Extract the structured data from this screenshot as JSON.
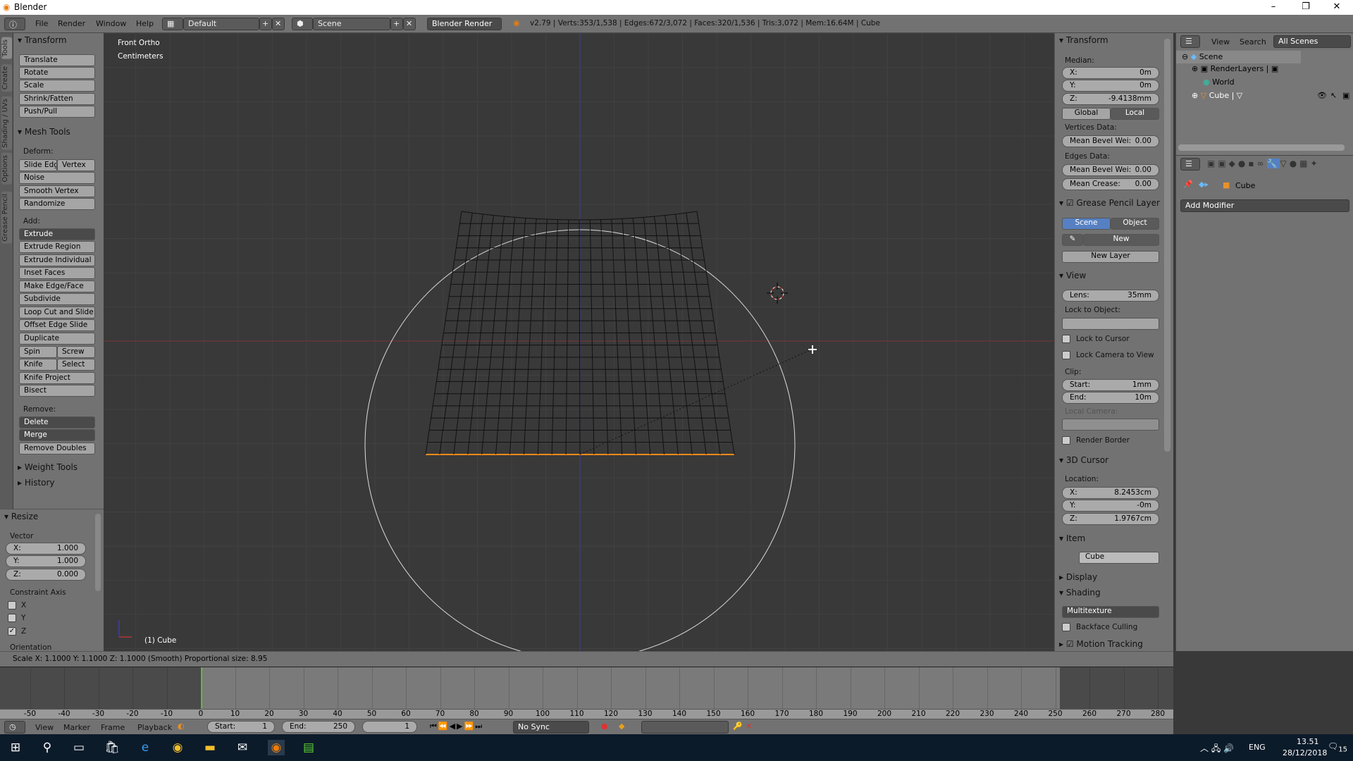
{
  "window": {
    "title": "Blender",
    "controls": [
      "–",
      "❐",
      "✕"
    ]
  },
  "menubar": {
    "menus": [
      "File",
      "Render",
      "Window",
      "Help"
    ],
    "layout": "Default",
    "scene": "Scene",
    "engine": "Blender Render",
    "stats": "v2.79 | Verts:353/1,538 | Edges:672/3,072 | Faces:320/1,536 | Tris:3,072 | Mem:16.64M | Cube"
  },
  "tool_tabs": [
    "Tools",
    "Create",
    "Shading / UVs",
    "Options",
    "Grease Pencil"
  ],
  "toolshelf": {
    "transform": {
      "title": "Transform",
      "buttons": [
        "Translate",
        "Rotate",
        "Scale",
        "Shrink/Fatten",
        "Push/Pull"
      ]
    },
    "mesh_tools": {
      "title": "Mesh Tools",
      "deform_label": "Deform:",
      "slide_edge": "Slide Edg",
      "vertex": "Vertex",
      "deform": [
        "Noise",
        "Smooth Vertex",
        "Randomize"
      ],
      "add_label": "Add:",
      "extrude": "Extrude",
      "add": [
        "Extrude Region",
        "Extrude Individual",
        "Inset Faces",
        "Make Edge/Face",
        "Subdivide",
        "Loop Cut and Slide",
        "Offset Edge Slide"
      ],
      "duplicate": "Duplicate",
      "spin": "Spin",
      "screw": "Screw",
      "knife": "Knife",
      "select": "Select",
      "knife_project": "Knife Project",
      "bisect": "Bisect",
      "remove_label": "Remove:",
      "delete": "Delete",
      "merge": "Merge",
      "remove_doubles": "Remove Doubles"
    },
    "weight_tools": "Weight Tools",
    "history": "History"
  },
  "operator": {
    "title": "Resize",
    "vector_label": "Vector",
    "x": {
      "label": "X:",
      "value": "1.000"
    },
    "y": {
      "label": "Y:",
      "value": "1.000"
    },
    "z": {
      "label": "Z:",
      "value": "0.000"
    },
    "constraint_label": "Constraint Axis",
    "axes": [
      {
        "label": "X",
        "checked": false
      },
      {
        "label": "Y",
        "checked": false
      },
      {
        "label": "Z",
        "checked": true
      }
    ],
    "orientation_label": "Orientation"
  },
  "viewport": {
    "view_name": "Front Ortho",
    "units": "Centimeters",
    "object_label": "(1) Cube",
    "colors": {
      "x_axis": "#8a3a3a",
      "z_axis": "#3a3a9a",
      "mesh": "#111111",
      "selected": "#ff8c1a"
    }
  },
  "npanel": {
    "transform": {
      "title": "Transform",
      "median_label": "Median:",
      "x": {
        "label": "X:",
        "value": "0m"
      },
      "y": {
        "label": "Y:",
        "value": "0m"
      },
      "z": {
        "label": "Z:",
        "value": "-9.4138mm"
      },
      "global": "Global",
      "local": "Local",
      "vertices_label": "Vertices Data:",
      "v_bevel": {
        "label": "Mean Bevel Wei:",
        "value": "0.00"
      },
      "edges_label": "Edges Data:",
      "e_bevel": {
        "label": "Mean Bevel Wei:",
        "value": "0.00"
      },
      "crease": {
        "label": "Mean Crease:",
        "value": "0.00"
      }
    },
    "grease": {
      "title": "Grease Pencil Layer",
      "scene": "Scene",
      "object": "Object",
      "new": "New",
      "new_layer": "New Layer"
    },
    "view": {
      "title": "View",
      "lens": {
        "label": "Lens:",
        "value": "35mm"
      },
      "lock_object_label": "Lock to Object:",
      "lock_cursor": "Lock to Cursor",
      "lock_camera": "Lock Camera to View",
      "clip_label": "Clip:",
      "start": {
        "label": "Start:",
        "value": "1mm"
      },
      "end": {
        "label": "End:",
        "value": "10m"
      },
      "local_camera_label": "Local Camera:",
      "render_border": "Render Border"
    },
    "cursor": {
      "title": "3D Cursor",
      "location_label": "Location:",
      "x": {
        "label": "X:",
        "value": "8.2453cm"
      },
      "y": {
        "label": "Y:",
        "value": "-0m"
      },
      "z": {
        "label": "Z:",
        "value": "1.9767cm"
      }
    },
    "item": {
      "title": "Item",
      "name": "Cube"
    },
    "display": "Display",
    "shading": {
      "title": "Shading",
      "mode": "Multitexture",
      "backface": "Backface Culling"
    },
    "motion_tracking": "Motion Tracking"
  },
  "outliner": {
    "view": "View",
    "search": "Search",
    "filter": "All Scenes",
    "items": [
      {
        "label": "Scene",
        "depth": 0
      },
      {
        "label": "RenderLayers",
        "depth": 1
      },
      {
        "label": "World",
        "depth": 1
      },
      {
        "label": "Cube",
        "depth": 1
      }
    ]
  },
  "properties": {
    "object": "Cube",
    "add_modifier": "Add Modifier"
  },
  "status": "Scale X: 1.1000   Y: 1.1000   Z: 1.1000 (Smooth) Proportional size: 8.95",
  "timeline": {
    "current_frame": 0,
    "ticks": [
      "-50",
      "-40",
      "-30",
      "-20",
      "-10",
      "0",
      "10",
      "20",
      "30",
      "40",
      "50",
      "60",
      "70",
      "80",
      "90",
      "100",
      "110",
      "120",
      "130",
      "140",
      "150",
      "160",
      "170",
      "180",
      "190",
      "200",
      "210",
      "220",
      "230",
      "240",
      "250",
      "260",
      "270",
      "280"
    ],
    "menus": [
      "View",
      "Marker",
      "Frame",
      "Playback"
    ],
    "start": {
      "label": "Start:",
      "value": "1"
    },
    "end": {
      "label": "End:",
      "value": "250"
    },
    "frame": "1",
    "sync": "No Sync"
  },
  "taskbar": {
    "lang": "ENG",
    "time": "13.51",
    "date": "28/12/2018",
    "notifications": "15"
  }
}
